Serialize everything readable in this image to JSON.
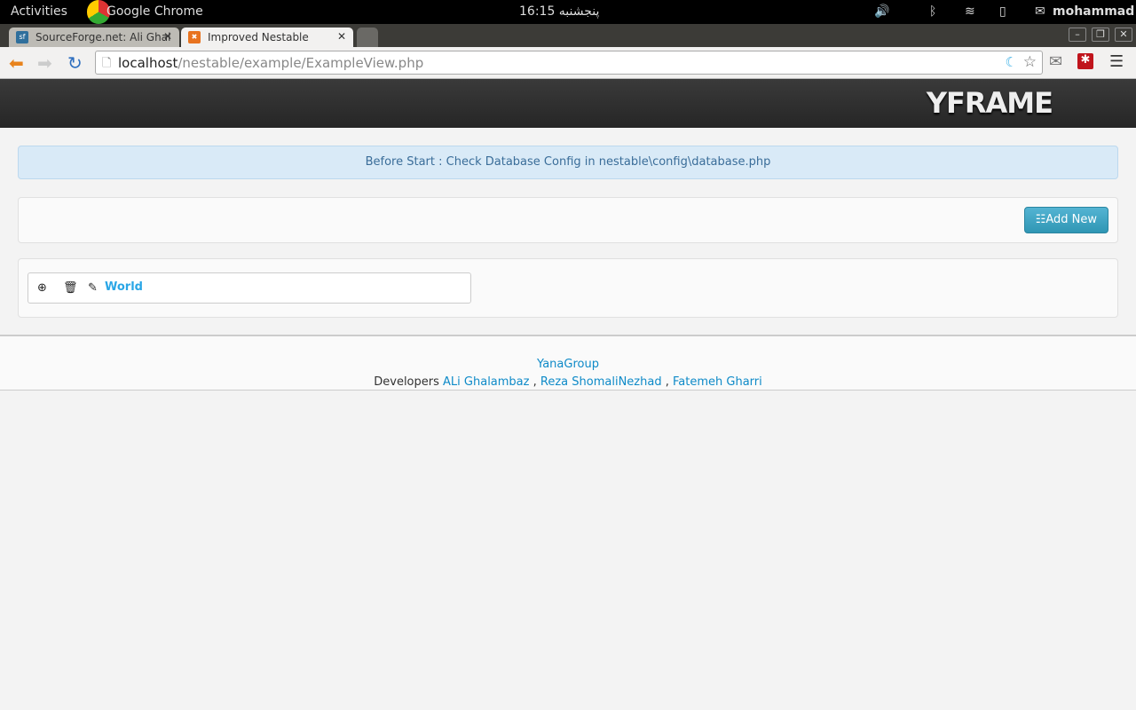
{
  "system": {
    "activities": "Activities",
    "app": "Google Chrome",
    "clock": "16:15 پنجشنبه",
    "user": "mohammad"
  },
  "tabs": [
    {
      "label": "SourceForge.net: Ali Ghal",
      "favicon": "sf"
    },
    {
      "label": "Improved Nestable",
      "active": true
    }
  ],
  "url": {
    "host": "localhost",
    "path": "/nestable/example/ExampleView.php"
  },
  "header": {
    "logo": "YFRAME"
  },
  "alert": "Before Start : Check Database Config in nestable\\config\\database.php",
  "actions": {
    "add_new": "Add New"
  },
  "list": [
    {
      "label": "World"
    }
  ],
  "footer": {
    "group": "YanaGroup",
    "developers_label": "Developers",
    "developers": [
      "ALi Ghalambaz",
      "Reza ShomaliNezhad",
      "Fatemeh Gharri"
    ],
    "sep": ","
  },
  "colors": {
    "accent": "#2f96b4",
    "link": "#0e8ac8"
  }
}
